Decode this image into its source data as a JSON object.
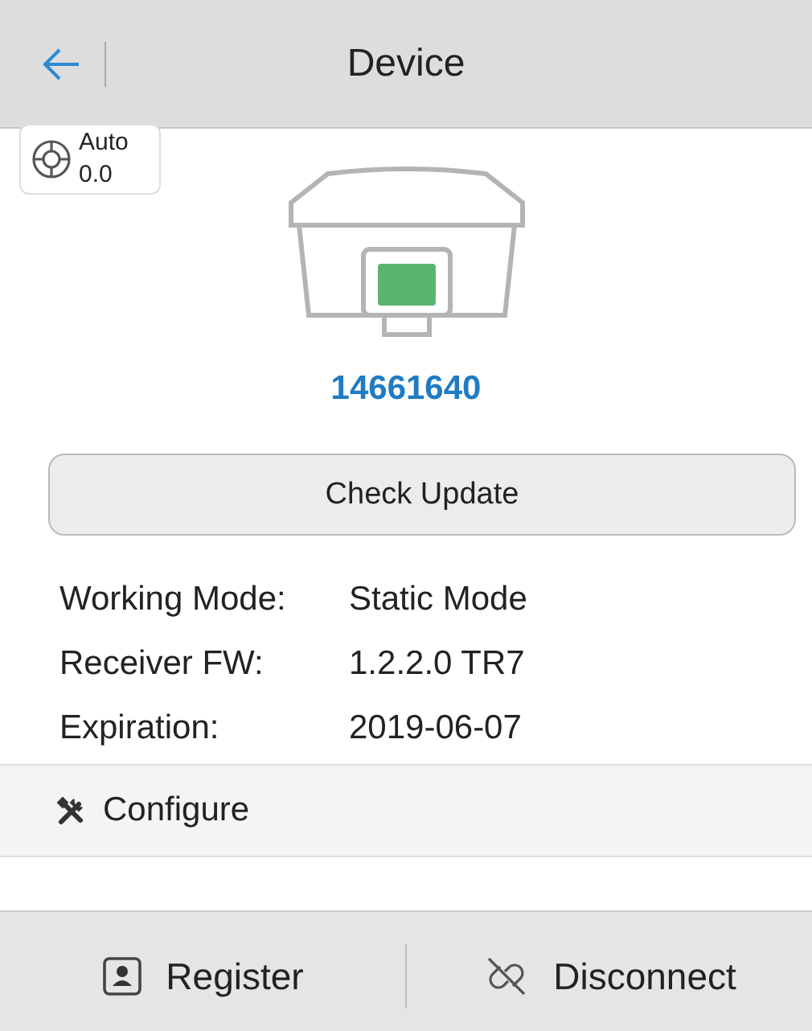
{
  "header": {
    "title": "Device"
  },
  "position_badge": {
    "mode": "Auto",
    "value": "0.0"
  },
  "device": {
    "serial": "14661640"
  },
  "check_update_button": "Check Update",
  "info_rows": [
    {
      "label": "Working Mode:",
      "value": "Static Mode"
    },
    {
      "label": "Receiver FW:",
      "value": "1.2.2.0  TR7"
    },
    {
      "label": "Expiration:",
      "value": "2019-06-07"
    }
  ],
  "section": {
    "title": "Configure"
  },
  "footer_buttons": [
    {
      "kind": "register",
      "label": "Register"
    },
    {
      "kind": "disconnect",
      "label": "Disconnect"
    }
  ]
}
